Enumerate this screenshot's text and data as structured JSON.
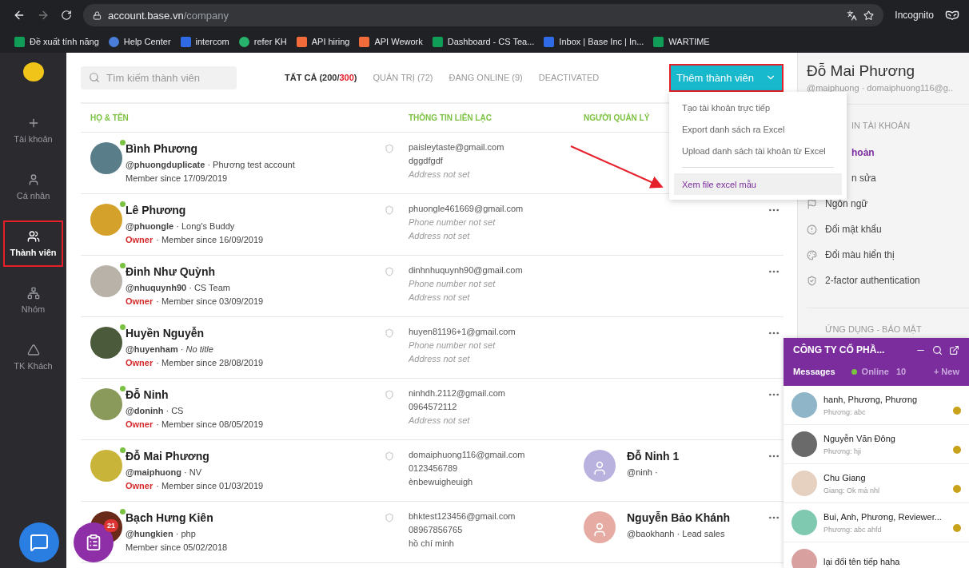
{
  "browser": {
    "url_host": "account.base.vn",
    "url_path": "/company",
    "profile": "Incognito",
    "bookmarks": [
      {
        "label": "Đề xuất tính năng",
        "kind": "sheet"
      },
      {
        "label": "Help Center",
        "kind": "hex"
      },
      {
        "label": "intercom",
        "kind": "intercom"
      },
      {
        "label": "refer KH",
        "kind": "ring"
      },
      {
        "label": "API hiring",
        "kind": "api"
      },
      {
        "label": "API Wework",
        "kind": "api"
      },
      {
        "label": "Dashboard - CS Tea...",
        "kind": "sheet"
      },
      {
        "label": "Inbox | Base Inc | In...",
        "kind": "intercom"
      },
      {
        "label": "WARTIME",
        "kind": "sheet"
      }
    ]
  },
  "sidebar": {
    "items": [
      {
        "label": "Tài khoản",
        "kind": "plus",
        "selected": false,
        "annotated": false
      },
      {
        "label": "Cá nhân",
        "kind": "person",
        "selected": false,
        "annotated": false
      },
      {
        "label": "Thành viên",
        "kind": "people",
        "selected": true,
        "annotated": true
      },
      {
        "label": "Nhóm",
        "kind": "tree",
        "selected": false,
        "annotated": false
      },
      {
        "label": "TK Khách",
        "kind": "triangle",
        "selected": false,
        "annotated": false
      }
    ]
  },
  "toolbar": {
    "search": {
      "placeholder": "Tìm kiếm thành viên"
    },
    "tabs": [
      {
        "label": "TẤT CẢ (200/",
        "highlight": "300",
        "suffix": ")",
        "selected": true
      },
      {
        "label": "QUẢN TRỊ (72)",
        "selected": false
      },
      {
        "label": "ĐANG ONLINE (9)",
        "selected": false
      },
      {
        "label": "DEACTIVATED",
        "selected": false
      }
    ],
    "add_button": {
      "label": "Thêm thành viên",
      "annotated": true
    }
  },
  "columns": [
    "HỌ & TÊN",
    "THÔNG TIN LIÊN LẠC",
    "NGƯỜI QUẢN LÝ"
  ],
  "rows": [
    {
      "name": "Bình Phương",
      "meta": "**@phuongduplicate** · Phương test account",
      "online": true,
      "since": "Member since 17/09/2019",
      "contact": [
        {
          "text": "paisleytaste@gmail.com",
          "missing": false
        },
        {
          "text": "dggdfgdf",
          "missing": false
        },
        {
          "text": "Address not set",
          "missing": true
        }
      ]
    },
    {
      "name": "Lê Phương",
      "meta": "**@phuongle** · Long's Buddy",
      "online": true,
      "role": "Owner",
      "since": "· Member since 16/09/2019",
      "contact": [
        {
          "text": "phuongle461669@gmail.com",
          "missing": false
        },
        {
          "text": "Phone number not set",
          "missing": true
        },
        {
          "text": "Address not set",
          "missing": true
        }
      ]
    },
    {
      "name": "Đinh Như Quỳnh",
      "meta": "**@nhuquynh90** · CS Team",
      "online": true,
      "role": "Owner",
      "since": "· Member since 03/09/2019",
      "contact": [
        {
          "text": "dinhnhuquynh90@gmail.com",
          "missing": false
        },
        {
          "text": "Phone number not set",
          "missing": true
        },
        {
          "text": "Address not set",
          "missing": true
        }
      ]
    },
    {
      "name": "Huyền Nguyễn",
      "meta": "**@huyenham** · *No title*",
      "online": true,
      "role": "Owner",
      "since": "· Member since 28/08/2019",
      "contact": [
        {
          "text": "huyen81196+1@gmail.com",
          "missing": false
        },
        {
          "text": "Phone number not set",
          "missing": true
        },
        {
          "text": "Address not set",
          "missing": true
        }
      ]
    },
    {
      "name": "Đỗ Ninh",
      "meta": "**@doninh** · CS",
      "online": true,
      "role": "Owner",
      "since": "· Member since 08/05/2019",
      "contact": [
        {
          "text": "ninhdh.2112@gmail.com",
          "missing": false
        },
        {
          "text": "0964572112",
          "missing": false
        },
        {
          "text": "Address not set",
          "missing": true
        }
      ]
    },
    {
      "name": "Đỗ Mai Phương",
      "meta": "**@maiphuong** · NV",
      "online": true,
      "role": "Owner",
      "since": "· Member since 01/03/2019",
      "contact": [
        {
          "text": "domaiphuong116@gmail.com",
          "missing": false
        },
        {
          "text": "0123456789",
          "missing": false
        },
        {
          "text": "ènbewuigheuigh",
          "missing": false
        }
      ],
      "manager": {
        "name": "Đỗ Ninh 1",
        "meta": "@ninh ·",
        "color": "#b9b1de"
      }
    },
    {
      "name": "Bạch Hưng Kiên",
      "meta": "**@hungkien** · php",
      "online": true,
      "since": "Member since 05/02/2018",
      "contact": [
        {
          "text": "bhktest123456@gmail.com",
          "missing": false
        },
        {
          "text": "08967856765",
          "missing": false
        },
        {
          "text": "hồ chí minh",
          "missing": false
        }
      ],
      "manager": {
        "name": "Nguyễn Bảo Khánh",
        "meta": "@baokhanh · Lead sales",
        "color": "#e6aca4"
      }
    }
  ],
  "dropdown": {
    "groups": [
      [
        {
          "label": "Tạo tài khoản trực tiếp",
          "selected": false
        },
        {
          "label": "Export danh sách ra Excel",
          "selected": false
        },
        {
          "label": "Upload danh sách tài khoản từ Excel",
          "selected": false
        }
      ],
      [
        {
          "label": "Xem file excel mẫu",
          "selected": true
        }
      ]
    ]
  },
  "profile": {
    "name": "Đỗ Mai Phương",
    "meta": "@maiphuong · domaiphuong116@g..",
    "sections": [
      {
        "title": "IN TÀI KHOẢN",
        "items": [
          {
            "label": "hoản",
            "kind": "partial",
            "selected": true
          },
          {
            "label": "n sửa",
            "kind": "partial",
            "selected": false
          },
          {
            "label": "Ngôn ngữ",
            "kind": "flag",
            "selected": false
          },
          {
            "label": "Đổi mật khẩu",
            "kind": "alert",
            "selected": false
          },
          {
            "label": "Đổi màu hiển thị",
            "kind": "palette",
            "selected": false
          },
          {
            "label": "2-factor authentication",
            "kind": "shield",
            "selected": false
          }
        ]
      },
      {
        "title": "ỨNG DỤNG - BẢO MẬT"
      }
    ]
  },
  "chat": {
    "title": "CÔNG TY CỔ PHẦ...",
    "tabs": [
      {
        "label": "Messages",
        "selected": true,
        "kind": "plain"
      },
      {
        "label": "Online",
        "count": "10",
        "selected": false,
        "kind": "online"
      },
      {
        "label": "+ New",
        "selected": false,
        "kind": "plain"
      }
    ],
    "conversations": [
      {
        "title": "hanh, Phương, Phương",
        "preview": "Phương: abc"
      },
      {
        "title": "Nguyễn Văn Đông",
        "preview": "Phương: hji"
      },
      {
        "title": "Chu Giang",
        "preview": "Giang: Ok mà nhỉ"
      },
      {
        "title": "Bui, Anh, Phương, Reviewer...",
        "preview": "Phương: abc ahfd"
      },
      {
        "title": "lại đổi tên tiếp haha"
      }
    ]
  },
  "floating": {
    "badge": "21"
  }
}
